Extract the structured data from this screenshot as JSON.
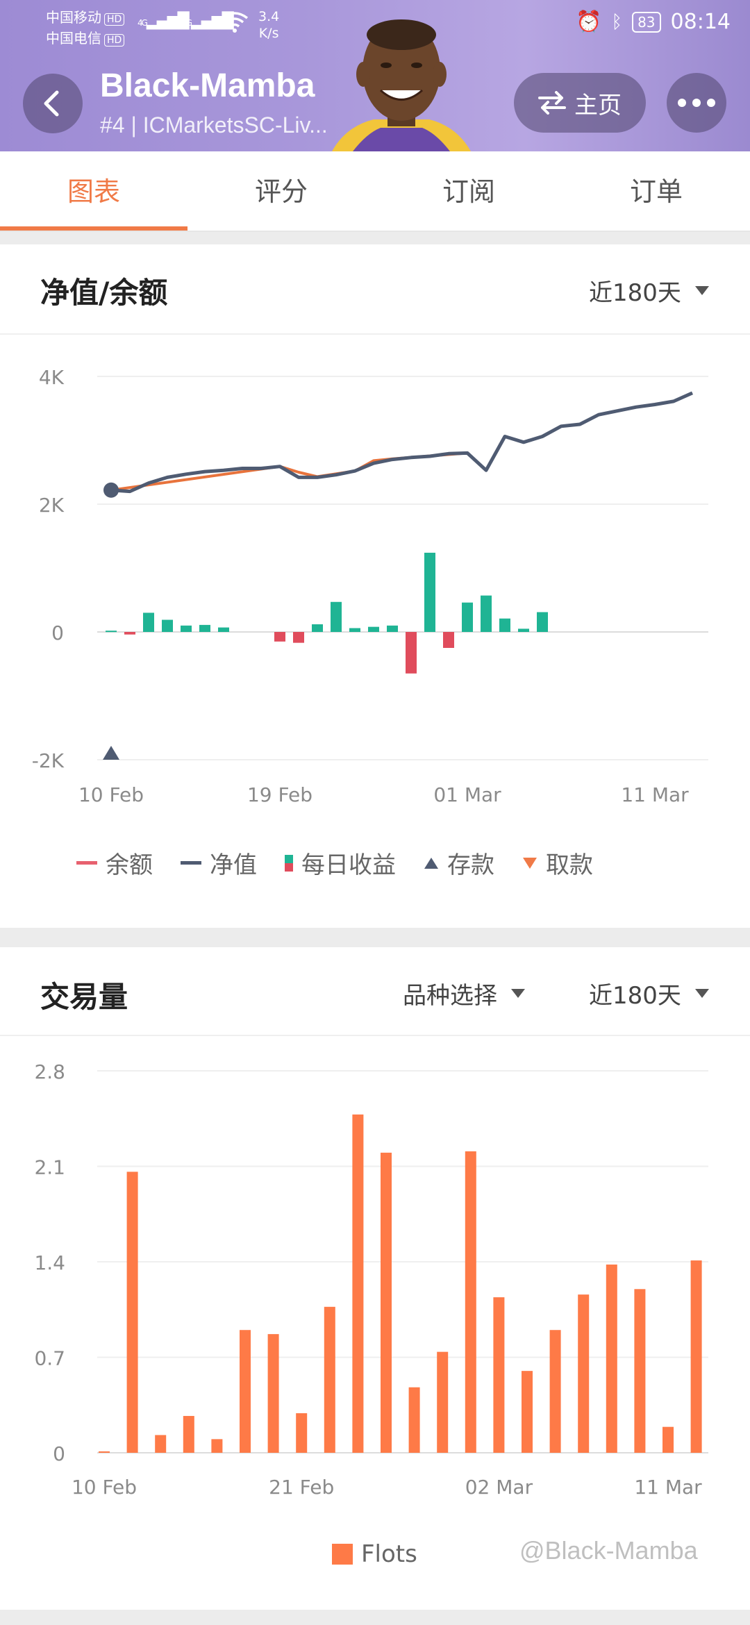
{
  "status_bar": {
    "carrier1": "中国移动",
    "carrier2": "中国电信",
    "hd": "HD",
    "net": "4G",
    "speed_value": "3.4",
    "speed_unit": "K/s",
    "battery": "83",
    "time": "08:14"
  },
  "header": {
    "title": "Black-Mamba",
    "subtitle": "#4 | ICMarketsSC-Liv...",
    "home_label": "主页",
    "back_icon": "back-arrow-icon",
    "home_icon": "swap-icon",
    "more_icon": "more-dots-icon",
    "avatar_icon": "avatar-photo"
  },
  "tabs": [
    {
      "label": "图表",
      "active": true
    },
    {
      "label": "评分",
      "active": false
    },
    {
      "label": "订阅",
      "active": false
    },
    {
      "label": "订单",
      "active": false
    }
  ],
  "equity_card": {
    "title": "净值/余额",
    "range": "近180天",
    "legend": {
      "balance": "余额",
      "equity": "净值",
      "daily": "每日收益",
      "deposit": "存款",
      "withdraw": "取款"
    }
  },
  "volume_card": {
    "title": "交易量",
    "symbol_select": "品种选择",
    "range": "近180天",
    "legend": "Flots"
  },
  "watermark": "@Black-Mamba",
  "colors": {
    "accent": "#f07a47",
    "equity_line": "#4f5b72",
    "balance_line": "#e8733c",
    "gain_bar": "#1fb494",
    "loss_bar": "#e04c5c",
    "volume_bar": "#fe7a47"
  },
  "chart_data": [
    {
      "type": "line",
      "title": "净值/余额",
      "ylim": [
        -2000,
        4000
      ],
      "y_ticks": [
        "4K",
        "2K",
        "0",
        "-2K"
      ],
      "x_tick_labels": [
        "10 Feb",
        "19 Feb",
        "01 Mar",
        "11 Mar"
      ],
      "series": [
        {
          "name": "净值",
          "x": [
            "10 Feb",
            "11 Feb",
            "12 Feb",
            "13 Feb",
            "14 Feb",
            "15 Feb",
            "16 Feb",
            "17 Feb",
            "18 Feb",
            "19 Feb",
            "20 Feb",
            "21 Feb",
            "22 Feb",
            "23 Feb",
            "24 Feb",
            "25 Feb",
            "26 Feb",
            "27 Feb",
            "28 Feb",
            "01 Mar",
            "02 Mar",
            "03 Mar",
            "04 Mar",
            "05 Mar",
            "06 Mar",
            "07 Mar",
            "08 Mar",
            "09 Mar",
            "10 Mar",
            "11 Mar",
            "12 Mar",
            "13 Mar"
          ],
          "values": [
            2220,
            2200,
            2330,
            2420,
            2470,
            2510,
            2530,
            2560,
            2560,
            2590,
            2420,
            2420,
            2460,
            2520,
            2640,
            2700,
            2730,
            2750,
            2790,
            2800,
            2530,
            3060,
            2970,
            3060,
            3220,
            3250,
            3400,
            3460,
            3520,
            3560,
            3610,
            3740
          ]
        },
        {
          "name": "余额",
          "x": [
            "10 Feb",
            "19 Feb",
            "20 Feb",
            "21 Feb",
            "23 Feb",
            "24 Feb",
            "25 Feb",
            "01 Mar"
          ],
          "values": [
            2220,
            2590,
            2500,
            2430,
            2520,
            2680,
            2710,
            2800
          ]
        }
      ],
      "daily_bars": {
        "name": "每日收益",
        "x": [
          "10 Feb",
          "11 Feb",
          "12 Feb",
          "13 Feb",
          "14 Feb",
          "15 Feb",
          "16 Feb",
          "19 Feb",
          "20 Feb",
          "21 Feb",
          "22 Feb",
          "23 Feb",
          "24 Feb",
          "25 Feb",
          "26 Feb",
          "27 Feb",
          "28 Feb",
          "01 Mar",
          "02 Mar",
          "03 Mar",
          "04 Mar",
          "05 Mar",
          "06 Mar",
          "07 Mar",
          "08 Mar"
        ],
        "values": [
          20,
          -40,
          300,
          190,
          100,
          110,
          70,
          -150,
          -170,
          120,
          470,
          60,
          80,
          100,
          -650,
          1240,
          -250,
          460,
          570,
          210,
          50,
          310,
          0,
          0,
          0
        ]
      },
      "deposit": {
        "name": "存款",
        "x": "10 Feb"
      }
    },
    {
      "type": "bar",
      "title": "交易量",
      "ylim": [
        0,
        2.8
      ],
      "y_ticks": [
        "2.8",
        "2.1",
        "1.4",
        "0.7",
        "0"
      ],
      "x_tick_labels": [
        "10 Feb",
        "21 Feb",
        "02 Mar",
        "11 Mar"
      ],
      "series": [
        {
          "name": "Flots",
          "values": [
            0.01,
            2.06,
            0.13,
            0.27,
            0.1,
            0.9,
            0.87,
            0.29,
            1.07,
            2.48,
            2.2,
            0.48,
            0.74,
            2.21,
            1.14,
            0.6,
            0.9,
            1.16,
            1.38,
            1.2,
            0.19,
            1.41
          ]
        }
      ]
    }
  ]
}
